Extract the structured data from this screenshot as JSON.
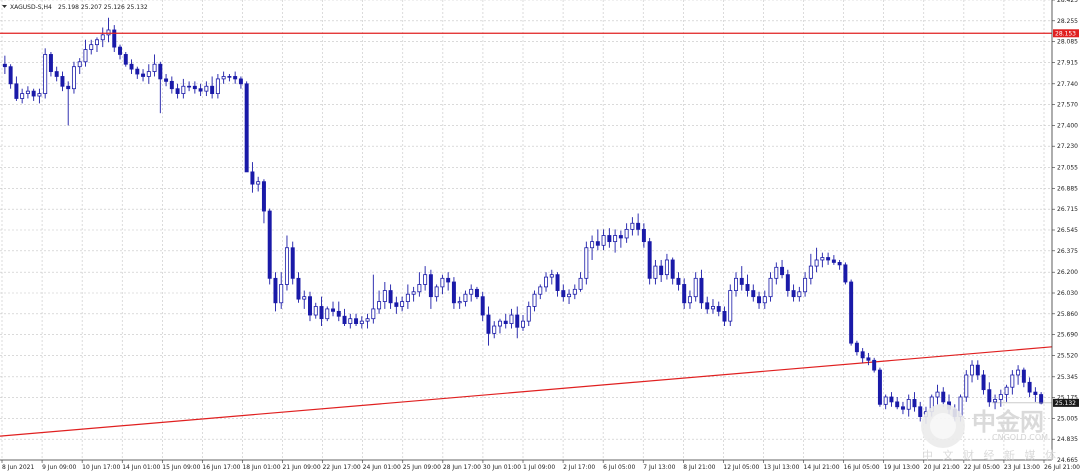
{
  "chart_data": {
    "type": "candlestick",
    "symbol": "XAGUSD-S,H4",
    "ohlc_header": "25.198 25.207 25.126 25.132",
    "ylim": [
      24.665,
      28.425
    ],
    "y_ticks": [
      24.835,
      25.005,
      25.175,
      25.345,
      25.52,
      25.69,
      25.86,
      26.03,
      26.2,
      26.375,
      26.545,
      26.715,
      26.885,
      27.055,
      27.23,
      27.4,
      27.57,
      27.74,
      27.915,
      28.085,
      28.255,
      28.425
    ],
    "y_tick_labels": [
      "24.835",
      "25.005",
      "25.175",
      "25.345",
      "25.520",
      "25.690",
      "25.860",
      "26.030",
      "26.200",
      "26.375",
      "26.545",
      "26.715",
      "26.885",
      "27.055",
      "27.230",
      "27.400",
      "27.570",
      "27.740",
      "27.915",
      "28.085",
      "28.255",
      "28.425"
    ],
    "bottom_label": "24.665",
    "x_tick_labels": [
      "8 Jun 2021",
      "9 Jun 09:00",
      "10 Jun 17:00",
      "14 Jun 01:00",
      "15 Jun 09:00",
      "16 Jun 17:00",
      "18 Jun 01:00",
      "21 Jun 09:00",
      "22 Jun 17:00",
      "24 Jun 01:00",
      "25 Jun 09:00",
      "28 Jun 17:00",
      "30 Jun 01:00",
      "1 Jul 09:00",
      "2 Jul 17:00",
      "6 Jul 05:00",
      "7 Jul 13:00",
      "8 Jul 21:00",
      "12 Jul 05:00",
      "13 Jul 13:00",
      "14 Jul 21:00",
      "16 Jul 05:00",
      "19 Jul 13:00",
      "20 Jul 21:00",
      "22 Jul 05:00",
      "23 Jul 13:00",
      "26 Jul 21:00"
    ],
    "horizontal_line": {
      "price": 28.153,
      "label": "28.153",
      "color": "#e02020"
    },
    "current_price": {
      "price": 25.132,
      "label": "25.132",
      "color": "#1a1a1a"
    },
    "trend_line": {
      "start_price": 24.86,
      "end_price": 25.59,
      "color": "#e02020"
    },
    "candle_color": "#1a1aa8",
    "grid": true,
    "candles": [
      [
        27.9,
        27.97,
        27.82,
        27.88
      ],
      [
        27.88,
        27.9,
        27.7,
        27.74
      ],
      [
        27.74,
        27.8,
        27.6,
        27.62
      ],
      [
        27.62,
        27.7,
        27.58,
        27.66
      ],
      [
        27.66,
        27.72,
        27.62,
        27.68
      ],
      [
        27.68,
        27.7,
        27.6,
        27.64
      ],
      [
        27.64,
        27.7,
        27.58,
        27.66
      ],
      [
        27.66,
        28.03,
        27.62,
        27.98
      ],
      [
        27.98,
        28.0,
        27.8,
        27.84
      ],
      [
        27.84,
        27.88,
        27.76,
        27.8
      ],
      [
        27.8,
        27.84,
        27.68,
        27.72
      ],
      [
        27.72,
        27.76,
        27.4,
        27.7
      ],
      [
        27.7,
        27.92,
        27.66,
        27.88
      ],
      [
        27.88,
        27.95,
        27.82,
        27.92
      ],
      [
        27.92,
        28.1,
        27.88,
        28.02
      ],
      [
        28.02,
        28.1,
        27.98,
        28.06
      ],
      [
        28.06,
        28.12,
        28.0,
        28.1
      ],
      [
        28.1,
        28.2,
        28.04,
        28.14
      ],
      [
        28.14,
        28.28,
        28.08,
        28.18
      ],
      [
        28.18,
        28.22,
        28.0,
        28.04
      ],
      [
        28.04,
        28.06,
        27.94,
        27.98
      ],
      [
        27.98,
        28.0,
        27.88,
        27.9
      ],
      [
        27.9,
        27.94,
        27.82,
        27.86
      ],
      [
        27.86,
        27.88,
        27.78,
        27.82
      ],
      [
        27.82,
        27.86,
        27.76,
        27.8
      ],
      [
        27.8,
        27.9,
        27.74,
        27.84
      ],
      [
        27.84,
        27.98,
        27.8,
        27.9
      ],
      [
        27.9,
        27.92,
        27.5,
        27.78
      ],
      [
        27.78,
        27.82,
        27.72,
        27.76
      ],
      [
        27.76,
        27.8,
        27.66,
        27.7
      ],
      [
        27.7,
        27.74,
        27.62,
        27.66
      ],
      [
        27.66,
        27.78,
        27.62,
        27.72
      ],
      [
        27.72,
        27.76,
        27.68,
        27.72
      ],
      [
        27.72,
        27.76,
        27.66,
        27.7
      ],
      [
        27.7,
        27.74,
        27.64,
        27.68
      ],
      [
        27.68,
        27.76,
        27.64,
        27.72
      ],
      [
        27.72,
        27.8,
        27.62,
        27.66
      ],
      [
        27.66,
        27.82,
        27.62,
        27.78
      ],
      [
        27.78,
        27.84,
        27.74,
        27.8
      ],
      [
        27.8,
        27.82,
        27.76,
        27.8
      ],
      [
        27.8,
        27.84,
        27.74,
        27.78
      ],
      [
        27.78,
        27.8,
        27.7,
        27.74
      ],
      [
        27.74,
        27.76,
        27.2,
        27.02
      ],
      [
        27.02,
        27.1,
        26.85,
        26.92
      ],
      [
        26.92,
        26.98,
        26.86,
        26.94
      ],
      [
        26.94,
        26.96,
        26.6,
        26.7
      ],
      [
        26.7,
        26.72,
        26.1,
        26.15
      ],
      [
        26.15,
        26.2,
        25.88,
        25.95
      ],
      [
        25.95,
        26.2,
        25.9,
        26.1
      ],
      [
        26.1,
        26.5,
        26.05,
        26.4
      ],
      [
        26.4,
        26.45,
        26.1,
        26.15
      ],
      [
        26.15,
        26.2,
        25.95,
        25.98
      ],
      [
        25.98,
        26.05,
        25.9,
        26.0
      ],
      [
        26.0,
        26.04,
        25.8,
        25.85
      ],
      [
        25.85,
        25.95,
        25.82,
        25.92
      ],
      [
        25.92,
        26.0,
        25.76,
        25.82
      ],
      [
        25.82,
        25.92,
        25.8,
        25.9
      ],
      [
        25.9,
        25.96,
        25.84,
        25.88
      ],
      [
        25.88,
        25.96,
        25.8,
        25.84
      ],
      [
        25.84,
        25.9,
        25.76,
        25.78
      ],
      [
        25.78,
        25.86,
        25.74,
        25.82
      ],
      [
        25.82,
        25.86,
        25.76,
        25.78
      ],
      [
        25.78,
        25.84,
        25.74,
        25.8
      ],
      [
        25.8,
        25.86,
        25.74,
        25.82
      ],
      [
        25.82,
        26.18,
        25.78,
        25.9
      ],
      [
        25.9,
        26.05,
        25.86,
        25.96
      ],
      [
        25.96,
        26.12,
        25.9,
        26.05
      ],
      [
        26.05,
        26.1,
        25.9,
        25.95
      ],
      [
        25.95,
        26.0,
        25.86,
        25.92
      ],
      [
        25.92,
        26.0,
        25.88,
        25.96
      ],
      [
        25.96,
        26.1,
        25.9,
        26.02
      ],
      [
        26.02,
        26.08,
        25.96,
        26.04
      ],
      [
        26.04,
        26.2,
        26.0,
        26.1
      ],
      [
        26.1,
        26.25,
        26.05,
        26.18
      ],
      [
        26.18,
        26.22,
        25.9,
        26.0
      ],
      [
        26.0,
        26.1,
        25.96,
        26.08
      ],
      [
        26.08,
        26.18,
        26.02,
        26.15
      ],
      [
        26.15,
        26.2,
        26.05,
        26.12
      ],
      [
        26.12,
        26.16,
        25.9,
        25.95
      ],
      [
        25.95,
        26.0,
        25.9,
        25.96
      ],
      [
        25.96,
        26.05,
        25.92,
        26.02
      ],
      [
        26.02,
        26.1,
        25.96,
        26.06
      ],
      [
        26.06,
        26.08,
        25.98,
        26.0
      ],
      [
        26.0,
        26.04,
        25.8,
        25.85
      ],
      [
        25.85,
        25.92,
        25.6,
        25.7
      ],
      [
        25.7,
        25.8,
        25.66,
        25.76
      ],
      [
        25.76,
        25.82,
        25.7,
        25.8
      ],
      [
        25.8,
        25.86,
        25.74,
        25.78
      ],
      [
        25.78,
        25.9,
        25.74,
        25.85
      ],
      [
        25.85,
        25.92,
        25.66,
        25.75
      ],
      [
        25.75,
        25.85,
        25.72,
        25.8
      ],
      [
        25.8,
        25.96,
        25.76,
        25.92
      ],
      [
        25.92,
        26.05,
        25.88,
        26.02
      ],
      [
        26.02,
        26.1,
        25.98,
        26.08
      ],
      [
        26.08,
        26.2,
        26.04,
        26.16
      ],
      [
        26.16,
        26.22,
        26.1,
        26.18
      ],
      [
        26.18,
        26.2,
        26.0,
        26.05
      ],
      [
        26.05,
        26.1,
        25.96,
        26.0
      ],
      [
        26.0,
        26.06,
        25.94,
        26.02
      ],
      [
        26.02,
        26.1,
        25.98,
        26.06
      ],
      [
        26.06,
        26.2,
        26.04,
        26.15
      ],
      [
        26.15,
        26.45,
        26.1,
        26.4
      ],
      [
        26.4,
        26.5,
        26.3,
        26.45
      ],
      [
        26.45,
        26.55,
        26.38,
        26.42
      ],
      [
        26.42,
        26.55,
        26.38,
        26.5
      ],
      [
        26.5,
        26.56,
        26.4,
        26.45
      ],
      [
        26.45,
        26.55,
        26.36,
        26.5
      ],
      [
        26.5,
        26.54,
        26.4,
        26.48
      ],
      [
        26.48,
        26.6,
        26.44,
        26.55
      ],
      [
        26.55,
        26.65,
        26.5,
        26.6
      ],
      [
        26.6,
        26.68,
        26.5,
        26.55
      ],
      [
        26.55,
        26.6,
        26.4,
        26.45
      ],
      [
        26.45,
        26.48,
        26.1,
        26.15
      ],
      [
        26.15,
        26.3,
        26.1,
        26.25
      ],
      [
        26.25,
        26.3,
        26.12,
        26.18
      ],
      [
        26.18,
        26.35,
        26.14,
        26.3
      ],
      [
        26.3,
        26.32,
        26.1,
        26.15
      ],
      [
        26.15,
        26.2,
        26.05,
        26.1
      ],
      [
        26.1,
        26.15,
        25.9,
        25.95
      ],
      [
        25.95,
        26.05,
        25.9,
        26.0
      ],
      [
        26.0,
        26.2,
        25.96,
        26.15
      ],
      [
        26.15,
        26.22,
        25.9,
        25.95
      ],
      [
        25.95,
        26.0,
        25.86,
        25.9
      ],
      [
        25.9,
        25.98,
        25.86,
        25.92
      ],
      [
        25.92,
        25.96,
        25.84,
        25.88
      ],
      [
        25.88,
        25.92,
        25.76,
        25.8
      ],
      [
        25.8,
        26.1,
        25.76,
        26.05
      ],
      [
        26.05,
        26.2,
        26.0,
        26.15
      ],
      [
        26.15,
        26.25,
        26.05,
        26.1
      ],
      [
        26.1,
        26.18,
        26.0,
        26.05
      ],
      [
        26.05,
        26.1,
        25.96,
        26.0
      ],
      [
        26.0,
        26.04,
        25.9,
        25.95
      ],
      [
        25.95,
        26.05,
        25.9,
        26.0
      ],
      [
        26.0,
        26.2,
        25.96,
        26.15
      ],
      [
        26.15,
        26.28,
        26.1,
        26.24
      ],
      [
        26.24,
        26.3,
        26.15,
        26.18
      ],
      [
        26.18,
        26.22,
        26.0,
        26.05
      ],
      [
        26.05,
        26.1,
        25.96,
        26.0
      ],
      [
        26.0,
        26.08,
        25.96,
        26.04
      ],
      [
        26.04,
        26.2,
        26.0,
        26.15
      ],
      [
        26.15,
        26.35,
        26.1,
        26.25
      ],
      [
        26.25,
        26.4,
        26.2,
        26.3
      ],
      [
        26.3,
        26.36,
        26.24,
        26.32
      ],
      [
        26.32,
        26.36,
        26.26,
        26.3
      ],
      [
        26.3,
        26.34,
        26.26,
        26.28
      ],
      [
        26.28,
        26.3,
        26.22,
        26.26
      ],
      [
        26.26,
        26.28,
        26.1,
        26.12
      ],
      [
        26.12,
        26.14,
        25.6,
        25.62
      ],
      [
        25.62,
        25.64,
        25.52,
        25.55
      ],
      [
        25.55,
        25.58,
        25.46,
        25.5
      ],
      [
        25.5,
        25.54,
        25.44,
        25.48
      ],
      [
        25.48,
        25.5,
        25.38,
        25.4
      ],
      [
        25.4,
        25.42,
        25.1,
        25.12
      ],
      [
        25.12,
        25.2,
        25.08,
        25.18
      ],
      [
        25.18,
        25.22,
        25.1,
        25.14
      ],
      [
        25.14,
        25.18,
        25.08,
        25.1
      ],
      [
        25.1,
        25.14,
        25.04,
        25.08
      ],
      [
        25.08,
        25.2,
        25.02,
        25.16
      ],
      [
        25.16,
        25.22,
        25.06,
        25.1
      ],
      [
        25.1,
        25.14,
        24.98,
        25.02
      ],
      [
        25.02,
        25.1,
        24.96,
        25.06
      ],
      [
        25.06,
        25.2,
        25.02,
        25.18
      ],
      [
        25.18,
        25.28,
        25.12,
        25.22
      ],
      [
        25.22,
        25.26,
        25.1,
        25.14
      ],
      [
        25.14,
        25.2,
        25.04,
        25.08
      ],
      [
        25.08,
        25.12,
        24.98,
        25.02
      ],
      [
        25.02,
        25.2,
        24.98,
        25.18
      ],
      [
        25.18,
        25.4,
        25.14,
        25.36
      ],
      [
        25.36,
        25.48,
        25.3,
        25.44
      ],
      [
        25.44,
        25.48,
        25.32,
        25.36
      ],
      [
        25.36,
        25.4,
        25.2,
        25.24
      ],
      [
        25.24,
        25.3,
        25.1,
        25.14
      ],
      [
        25.14,
        25.2,
        25.08,
        25.16
      ],
      [
        25.16,
        25.24,
        25.1,
        25.2
      ],
      [
        25.2,
        25.28,
        25.14,
        25.26
      ],
      [
        25.26,
        25.4,
        25.2,
        25.36
      ],
      [
        25.36,
        25.44,
        25.28,
        25.4
      ],
      [
        25.4,
        25.42,
        25.26,
        25.3
      ],
      [
        25.3,
        25.34,
        25.18,
        25.22
      ],
      [
        25.22,
        25.26,
        25.14,
        25.2
      ],
      [
        25.2,
        25.22,
        25.12,
        25.13
      ]
    ]
  },
  "watermark": {
    "brand_cn": "中金网",
    "brand_url": "CNGOLD.COM",
    "brand_sub": "中 文 财 经 新 媒 体"
  }
}
